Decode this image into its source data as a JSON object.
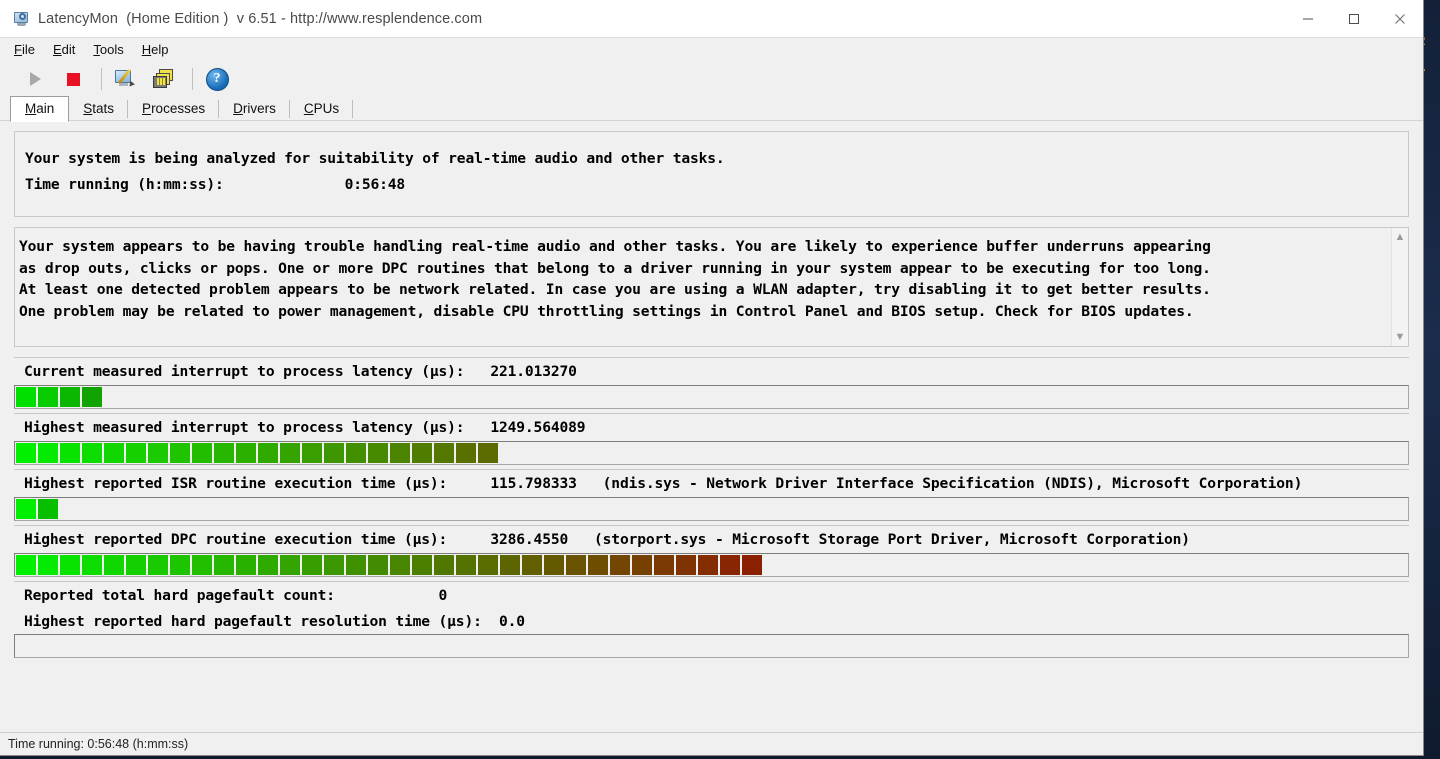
{
  "window": {
    "title": "LatencyMon  (Home Edition )  v 6.51 - http://www.resplendence.com",
    "icon": "latencymon-app-icon",
    "minimize_label": "—",
    "maximize_label": "□",
    "close_label": "✕"
  },
  "menubar": {
    "items": [
      {
        "label": "File",
        "mnemonic": "F"
      },
      {
        "label": "Edit",
        "mnemonic": "E"
      },
      {
        "label": "Tools",
        "mnemonic": "T"
      },
      {
        "label": "Help",
        "mnemonic": "H"
      }
    ]
  },
  "toolbar": {
    "buttons": [
      {
        "name": "start-button",
        "icon": "play-icon",
        "enabled": false
      },
      {
        "name": "stop-button",
        "icon": "stop-icon",
        "enabled": true
      },
      {
        "name": "report-button",
        "icon": "screen-pencil-icon",
        "enabled": true
      },
      {
        "name": "windows-button",
        "icon": "cascade-windows-icon",
        "enabled": true
      },
      {
        "name": "help-button",
        "icon": "help-circle-icon",
        "label": "?",
        "enabled": true
      }
    ]
  },
  "tabs": [
    {
      "label": "Main",
      "mnemonic": "M",
      "active": true
    },
    {
      "label": "Stats",
      "mnemonic": "S",
      "active": false
    },
    {
      "label": "Processes",
      "mnemonic": "P",
      "active": false
    },
    {
      "label": "Drivers",
      "mnemonic": "D",
      "active": false
    },
    {
      "label": "CPUs",
      "mnemonic": "C",
      "active": false
    }
  ],
  "summary": {
    "headline": "Your system is being analyzed for suitability of real-time audio and other tasks.",
    "time_label": "Time running (h:mm:ss):",
    "time_value": "0:56:48"
  },
  "alert": {
    "color": "#fb0b0b",
    "lines": [
      "Your system appears to be having trouble handling real-time audio and other tasks. You are likely to experience buffer underruns appearing",
      "as drop outs, clicks or pops. One or more DPC routines that belong to a driver running in your system appear to be executing for too long.",
      "At least one detected problem appears to be network related. In case you are using a WLAN adapter, try disabling it to get better results.",
      "One problem may be related to power management, disable CPU throttling settings in Control Panel and BIOS setup. Check for BIOS updates."
    ],
    "scroll_up_icon": "chevron-up-icon",
    "scroll_down_icon": "chevron-down-icon"
  },
  "metrics": [
    {
      "label": "Current measured interrupt to process latency (µs):",
      "value": "221.013270",
      "detail": "",
      "bar": {
        "segments": 4,
        "start_color": "#00e000",
        "end_color": "#11a300"
      }
    },
    {
      "label": "Highest measured interrupt to process latency (µs):",
      "value": "1249.564089",
      "detail": "",
      "bar": {
        "segments": 22,
        "start_color": "#00f000",
        "end_color": "#5d6a00"
      }
    },
    {
      "label": "Highest reported ISR routine execution time (µs):",
      "value": "115.798333",
      "detail": "(ndis.sys - Network Driver Interface Specification (NDIS), Microsoft Corporation)",
      "bar": {
        "segments": 2,
        "start_color": "#00ee00",
        "end_color": "#06c000"
      }
    },
    {
      "label": "Highest reported DPC routine execution time (µs):",
      "value": "3286.4550",
      "detail": "(storport.sys - Microsoft Storage Port Driver, Microsoft Corporation)",
      "bar": {
        "segments": 34,
        "start_color": "#00f000",
        "end_color": "#8b2000"
      }
    }
  ],
  "plain_metrics": [
    {
      "label": "Reported total hard pagefault count:",
      "value": "0"
    },
    {
      "label": "Highest reported hard pagefault resolution time (µs):",
      "value": "0.0"
    }
  ],
  "statusbar": {
    "text": "Time running: 0:56:48  (h:mm:ss)"
  },
  "desktop": {
    "edge_glyphs": [
      "R",
      "A"
    ]
  }
}
